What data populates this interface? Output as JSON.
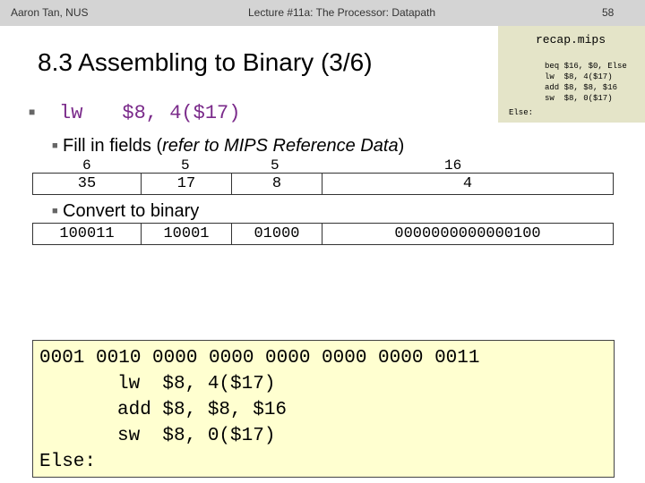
{
  "header": {
    "author": "Aaron Tan, NUS",
    "lecture": "Lecture #11a: The Processor: Datapath",
    "page": "58"
  },
  "title": "8.3 Assembling to Binary (3/6)",
  "recap": {
    "title": "recap.mips",
    "lines": [
      "beq $16, $0, Else",
      "lw  $8, 4($17)",
      "add $8, $8, $16",
      "sw  $8, 0($17)"
    ],
    "else_label": "Else:"
  },
  "instruction": {
    "keyword": "lw",
    "args": "$8, 4($17)"
  },
  "step1": {
    "prefix": "Fill in fields (",
    "ref_italic": "refer to MIPS Reference Data",
    "suffix": ")"
  },
  "field_widths": [
    "6",
    "5",
    "5",
    "16"
  ],
  "field_values": [
    "35",
    "17",
    "8",
    "4"
  ],
  "step2": "Convert to binary",
  "binary_fields": [
    "100011",
    "10001",
    "01000",
    "0000000000000100"
  ],
  "answer": {
    "binary": "0001 0010 0000 0000 0000 0000 0000 0011",
    "line_lw": "lw  $8, 4($17)",
    "line_add": "add $8, $8, $16",
    "line_sw": "sw  $8, 0($17)",
    "else_label": "Else:"
  },
  "colors": {
    "topbar": "#d4d4d4",
    "recap_bg": "#e4e4c8",
    "answer_bg": "#ffffd0",
    "keyword": "#7a2a8a"
  }
}
